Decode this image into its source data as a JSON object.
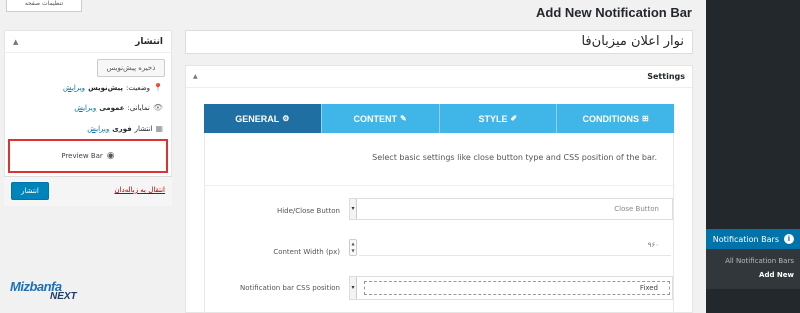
{
  "screen_options": "تنظیمات صفحه",
  "page_title": "Add New Notification Bar",
  "post_title": "نوار اعلان میزبان‌فا",
  "publish_box": {
    "title": "انتشار",
    "save_draft": "ذخیره پیش‌نویس",
    "status_label": "وضعیت:",
    "status_value": "پیش‌نویس",
    "status_edit": "ویرایش",
    "visibility_label": "نمایانی:",
    "visibility_value": "عمومی",
    "visibility_edit": "ویرایش",
    "publish_label": "انتشار",
    "publish_value": "فوری",
    "publish_edit": "ویرایش",
    "preview_bar": "Preview Bar",
    "trash": "انتقال به زباله‌دان",
    "publish_button": "انتشار"
  },
  "settings": {
    "title": "Settings",
    "tabs": [
      {
        "label": "GENERAL",
        "icon": "gear-icon",
        "active": true
      },
      {
        "label": "CONTENT",
        "icon": "pencil-icon",
        "active": false
      },
      {
        "label": "STYLE",
        "icon": "brush-icon",
        "active": false
      },
      {
        "label": "CONDITIONS",
        "icon": "plus-square-icon",
        "active": false
      }
    ],
    "description": "Select basic settings like close button type and CSS position of the bar.",
    "fields": {
      "hide_close_label": "Hide/Close Button",
      "hide_close_value": "Close Button",
      "content_width_label": "Content Width (px)",
      "content_width_value": "۹۶۰",
      "css_position_label": "Notification bar CSS position",
      "css_position_value": "Fixed"
    }
  },
  "admin_menu": {
    "current": "Notification Bars",
    "submenu": [
      "All Notification Bars",
      "Add New"
    ]
  },
  "logo": {
    "line1": "Mizbanfa",
    "line2": "NEXT"
  },
  "colors": {
    "accent": "#0073aa",
    "tab_active": "#1f6fa3",
    "tab": "#40b5e8",
    "highlight": "#dc3232"
  }
}
